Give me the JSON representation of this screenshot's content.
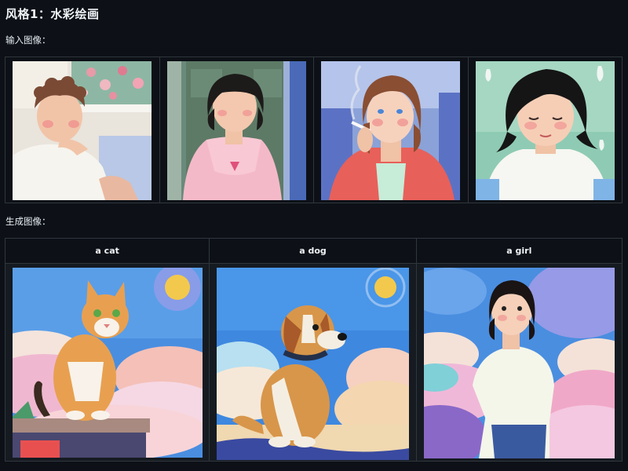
{
  "title": "风格1：水彩绘画",
  "input_label": "输入图像：",
  "output_label": "生成图像：",
  "output_columns": [
    "a cat",
    "a dog",
    "a girl"
  ]
}
